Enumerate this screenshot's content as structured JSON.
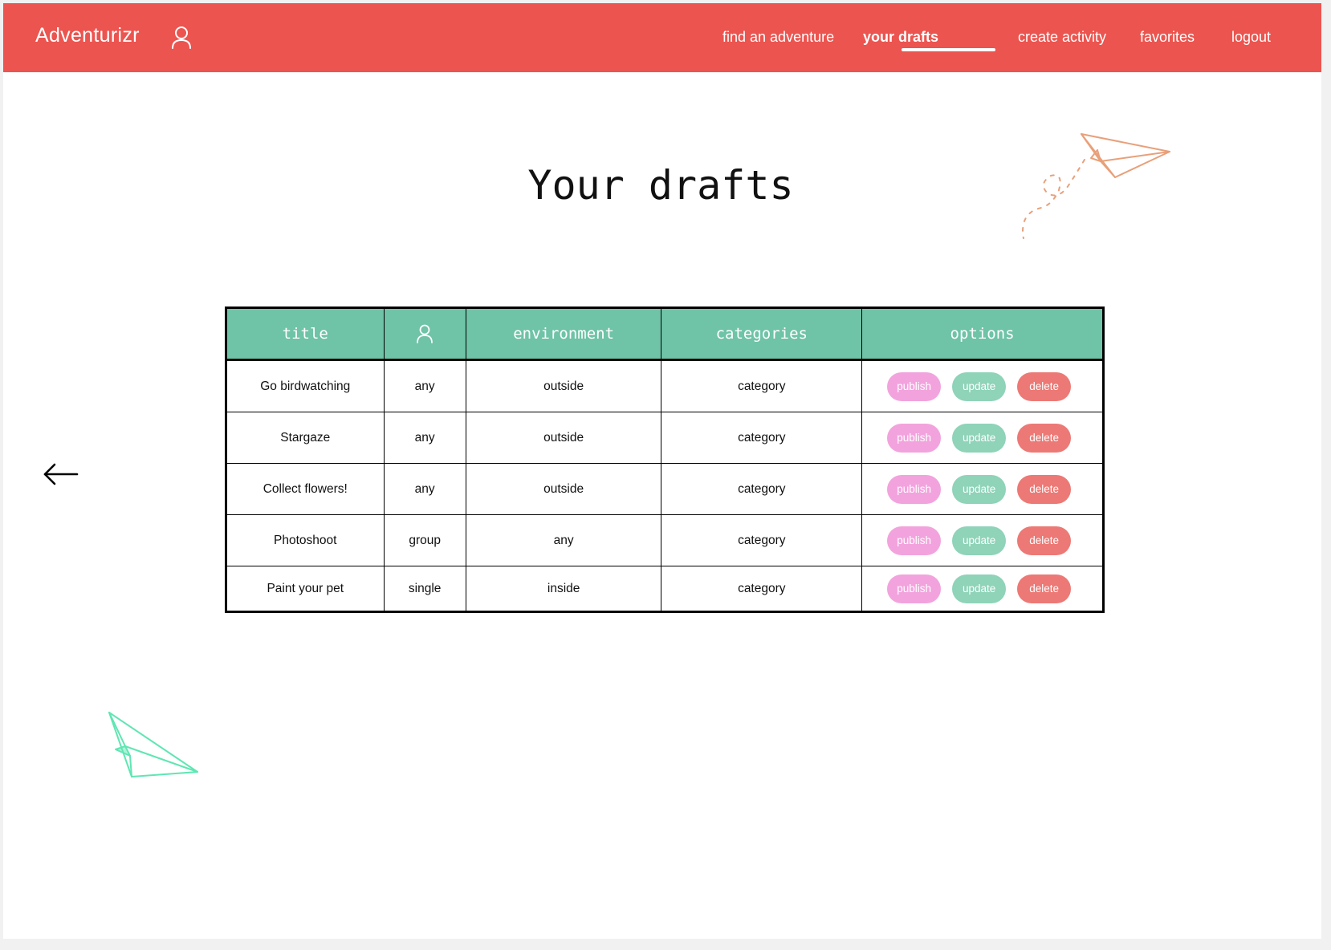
{
  "nav": {
    "brand": "Adventurizr",
    "user_icon": "user-icon",
    "links": [
      {
        "label": "find an adventure",
        "active": false
      },
      {
        "label": "your drafts",
        "active": true
      },
      {
        "label": "create activity",
        "active": false
      },
      {
        "label": "favorites",
        "active": false
      },
      {
        "label": "logout",
        "active": false
      }
    ]
  },
  "page": {
    "title": "Your drafts"
  },
  "back": {
    "icon": "arrow-left-icon"
  },
  "table": {
    "headers": {
      "title": "title",
      "group_icon": "user-icon",
      "environment": "environment",
      "categories": "categories",
      "options": "options"
    },
    "rows": [
      {
        "title": "Go birdwatching",
        "group": "any",
        "environment": "outside",
        "category": "category"
      },
      {
        "title": "Stargaze",
        "group": "any",
        "environment": "outside",
        "category": "category"
      },
      {
        "title": "Collect flowers!",
        "group": "any",
        "environment": "outside",
        "category": "category"
      },
      {
        "title": "Photoshoot",
        "group": "group",
        "environment": "any",
        "category": "category"
      },
      {
        "title": "Paint your pet",
        "group": "single",
        "environment": "inside",
        "category": "category"
      }
    ],
    "actions": {
      "publish": "publish",
      "update": "update",
      "delete": "delete"
    }
  },
  "decor": {
    "plane_top": "paper-plane-icon",
    "plane_bottom": "paper-plane-icon"
  },
  "colors": {
    "nav_bg": "#ec544f",
    "header_bg": "#6fc3a6",
    "publish": "#f2a3dd",
    "update": "#8fd3b9",
    "delete": "#ec7975",
    "plane_top": "#e8a07a",
    "plane_bottom": "#5fe6b3"
  }
}
